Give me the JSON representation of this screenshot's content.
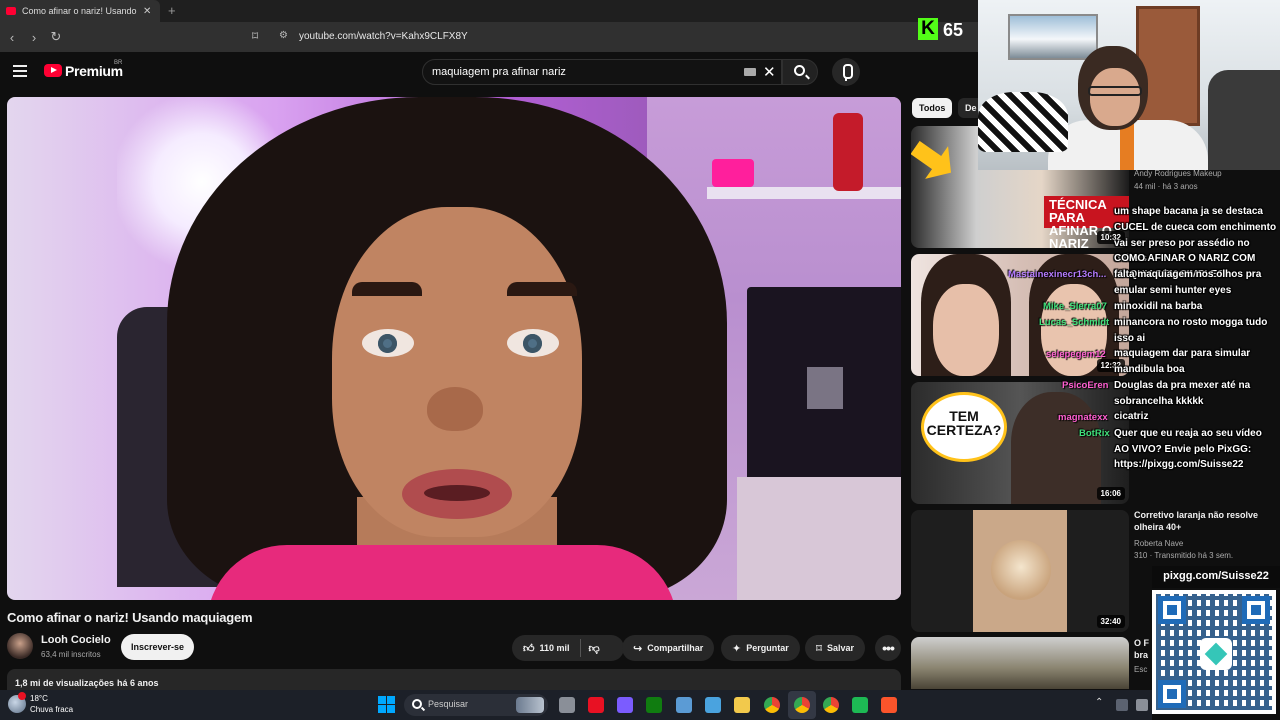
{
  "browser": {
    "tab_title": "Como afinar o nariz! Usando ma",
    "tab_close": "✕",
    "new_tab": "+",
    "back": "‹",
    "forward": "›",
    "reload": "↻",
    "bookmark_icon": "bookmark-icon",
    "url": "youtube.com/watch?v=Kahx9CLFX8Y"
  },
  "youtube": {
    "logo_text": "Premium",
    "logo_region": "BR",
    "search_query": "maquiagem pra afinar nariz",
    "clear_label": "✕"
  },
  "video": {
    "title": "Como afinar o nariz! Usando maquiagem",
    "channel_name": "Looh Cocielo",
    "channel_subs": "63,4 mil inscritos",
    "subscribe_label": "Inscrever-se",
    "like_count": "110 mil",
    "share_label": "Compartilhar",
    "ask_label": "Perguntar",
    "save_label": "Salvar",
    "more_label": "•••",
    "views": "1,8 mi de visualizações",
    "date": "há 6 anos"
  },
  "filters": {
    "all_label": "Todos",
    "second_label": "De"
  },
  "related": [
    {
      "title": "",
      "channel": "Andy Rodrigues Makeup",
      "meta": "44 mil · há 3 anos",
      "duration": "10:32",
      "tag_text": "TÉCNICA PARA AFINAR O NARIZ"
    },
    {
      "title": "",
      "channel": "",
      "meta": "",
      "duration": "12:32",
      "tag_text": ""
    },
    {
      "title": "",
      "channel": "",
      "meta": "",
      "duration": "16:06",
      "tag_text": "TEM CERTEZA?"
    },
    {
      "title": "Corretivo laranja não resolve olheira 40+",
      "channel": "Roberta Nave",
      "meta": "310 · Transmitido há 3 sem.",
      "duration": "32:40",
      "tag_text": ""
    },
    {
      "title": "O F bra",
      "channel": "Esc",
      "meta": "",
      "duration": "",
      "tag_text": ""
    }
  ],
  "overlay": {
    "kick_logo": "K",
    "kick_count": "65",
    "chat": [
      {
        "text": "um shape bacana ja se destaca"
      },
      {
        "text": "CUCEL de cueca com enchimento vai ser preso por assédio no onibus"
      },
      {
        "text": "COMO AFINAR O NARIZ COM MAQUIAGEM SIMPLES"
      },
      {
        "text": "falta maquiagem nos olhos pra emular semi hunter eyes"
      },
      {
        "text": "minoxidil na barba"
      },
      {
        "text": "minancora no rosto mogga tudo isso ai"
      },
      {
        "text": "maquiagem dar para simular mandibula boa"
      },
      {
        "text": "Douglas da pra mexer até na sobrancelha kkkkk"
      },
      {
        "text": "cicatriz"
      },
      {
        "text": "Quer que eu reaja ao seu vídeo AO VIVO? Envie pelo PixGG: https://pixgg.com/Suisse22"
      }
    ],
    "chat_users": [
      {
        "name": "Mastainexinecr13ch...",
        "color": "#b57bff"
      },
      {
        "name": "Mike_Slerra07",
        "color": "#3fe07a"
      },
      {
        "name": "Lucas_Schmidt",
        "color": "#3fe07a"
      },
      {
        "name": "selepegem12",
        "color": "#ff5fd1"
      },
      {
        "name": "PsicoEren",
        "color": "#ff5fd1"
      },
      {
        "name": "magnatexx",
        "color": "#ff5fd1"
      },
      {
        "name": "BotRix",
        "color": "#3fe07a"
      }
    ],
    "pix_label": "pixgg.com/Suisse22"
  },
  "taskbar": {
    "temp": "18°C",
    "condition": "Chuva fraca",
    "search_label": "Pesquisar"
  }
}
